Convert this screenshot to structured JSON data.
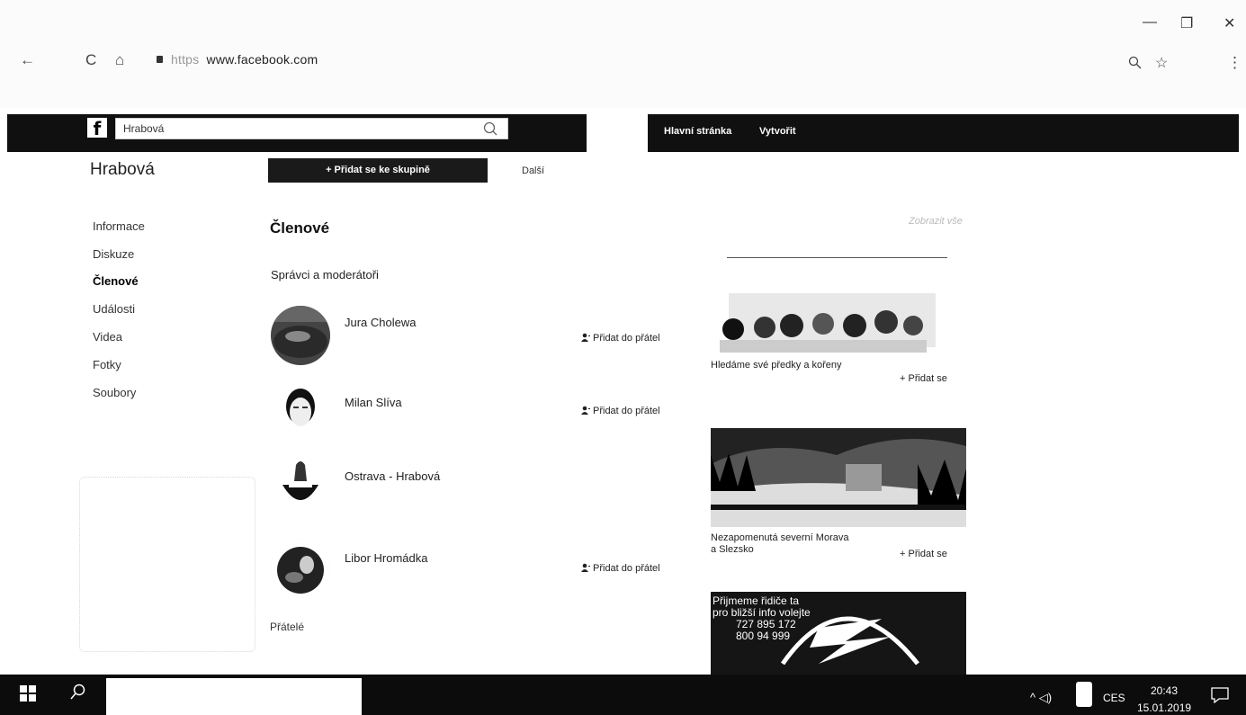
{
  "browser": {
    "url": "www.facebook.com",
    "url_scheme": "https",
    "back_glyph": "←",
    "reload_glyph": "C",
    "home_glyph": "⌂",
    "minimize_glyph": "—",
    "restore_glyph": "❐",
    "close_glyph": "✕",
    "zoom_glyph": "🔍",
    "star_glyph": "☆",
    "menu_glyph": "⋮"
  },
  "topbar": {
    "search_value": "Hrabová",
    "home_link": "Hlavní stránka",
    "create_link": "Vytvořit",
    "logo": "f"
  },
  "group": {
    "name": "Hrabová",
    "join_button": "+ Přidat se ke skupině",
    "more": "Další"
  },
  "sidebar": {
    "items": [
      {
        "label": "Informace"
      },
      {
        "label": "Diskuze"
      },
      {
        "label": "Členové"
      },
      {
        "label": "Události"
      },
      {
        "label": "Videa"
      },
      {
        "label": "Fotky"
      },
      {
        "label": "Soubory"
      }
    ]
  },
  "members": {
    "title": "Členové",
    "admins_title": "Správci a moderátoři",
    "add_label": "Přidat do přátel",
    "list": [
      {
        "name": "Jura Cholewa"
      },
      {
        "name": "Milan Slíva"
      },
      {
        "name": "Ostrava - Hrabová"
      },
      {
        "name": "Libor Hromádka"
      }
    ],
    "friends_title": "Přátelé"
  },
  "suggestions": {
    "header": "Zobrazit vše",
    "join_label": "Přidat se",
    "groups": [
      {
        "title": "Hledáme své předky a kořeny"
      },
      {
        "title": "Nezapomenutá severní Morava a Slezsko"
      }
    ],
    "ad_lines": [
      "Přijmeme řidiče ta",
      "pro bližší info volejte",
      "727 895 172",
      "800 94 999"
    ]
  },
  "taskbar": {
    "language": "CES",
    "time": "20:43",
    "date": "15.01.2019",
    "tray_glyphs": "^ ◁)"
  }
}
